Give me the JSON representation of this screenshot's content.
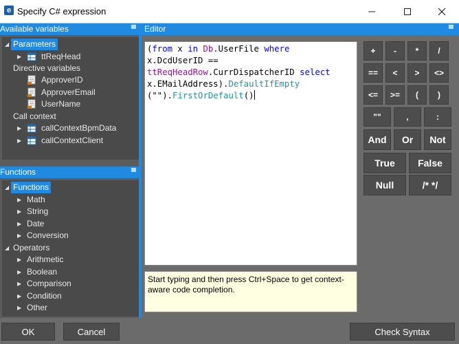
{
  "window": {
    "title": "Specify C# expression",
    "app_icon_letter": "e",
    "min_symbol": "—",
    "max_symbol": "☐",
    "close_symbol": "✕"
  },
  "variables_panel": {
    "header": "Available variables",
    "pin": "📌",
    "tree": [
      {
        "label": "Parameters",
        "selected": true
      },
      {
        "label": "ttReqHead"
      },
      {
        "label": "Directive variables"
      },
      {
        "label": "ApproverID"
      },
      {
        "label": "ApproverEmail"
      },
      {
        "label": "UserName"
      },
      {
        "label": "Call context"
      },
      {
        "label": "callContextBpmData"
      },
      {
        "label": "callContextClient"
      }
    ]
  },
  "functions_panel": {
    "header": "Functions",
    "pin": "📌",
    "tree": [
      {
        "label": "Functions",
        "selected": true
      },
      {
        "label": "Math"
      },
      {
        "label": "String"
      },
      {
        "label": "Date"
      },
      {
        "label": "Conversion"
      },
      {
        "label": "Operators"
      },
      {
        "label": "Arithmetic"
      },
      {
        "label": "Boolean"
      },
      {
        "label": "Comparison"
      },
      {
        "label": "Condition"
      },
      {
        "label": "Other"
      }
    ]
  },
  "editor": {
    "header": "Editor",
    "pin": "📌",
    "code_tokens": [
      {
        "t": "(",
        "c": ""
      },
      {
        "t": "from",
        "c": "kw"
      },
      {
        "t": " x ",
        "c": ""
      },
      {
        "t": "in",
        "c": "kw"
      },
      {
        "t": " ",
        "c": ""
      },
      {
        "t": "Db",
        "c": "id"
      },
      {
        "t": ".UserFile ",
        "c": ""
      },
      {
        "t": "where",
        "c": "kw"
      },
      {
        "t": "\nx.DcdUserID ==\n",
        "c": ""
      },
      {
        "t": "ttReqHeadRow",
        "c": "id"
      },
      {
        "t": ".CurrDispatcherID ",
        "c": ""
      },
      {
        "t": "select",
        "c": "kw"
      },
      {
        "t": "\nx.EMailAddress).",
        "c": ""
      },
      {
        "t": "DefaultIfEmpty",
        "c": "mth"
      },
      {
        "t": "\n(\"\").",
        "c": ""
      },
      {
        "t": "FirstOrDefault",
        "c": "mth"
      },
      {
        "t": "()",
        "c": ""
      }
    ],
    "hint": "Start typing and then press Ctrl+Space to get context-aware code completion."
  },
  "operators": [
    {
      "label": "+"
    },
    {
      "label": "-"
    },
    {
      "label": "*"
    },
    {
      "label": "/"
    },
    {
      "label": "=="
    },
    {
      "label": "<"
    },
    {
      "label": ">"
    },
    {
      "label": "<>"
    },
    {
      "label": "<="
    },
    {
      "label": ">="
    },
    {
      "label": "("
    },
    {
      "label": ")"
    },
    {
      "label": "\"\""
    },
    {
      "label": ","
    },
    {
      "label": ":"
    },
    {
      "label": "And"
    },
    {
      "label": "Or"
    },
    {
      "label": "Not"
    },
    {
      "label": "True"
    },
    {
      "label": "False"
    },
    {
      "label": "Null"
    },
    {
      "label": "/* */"
    }
  ],
  "buttons": {
    "ok": "OK",
    "cancel": "Cancel",
    "check_syntax": "Check Syntax"
  }
}
